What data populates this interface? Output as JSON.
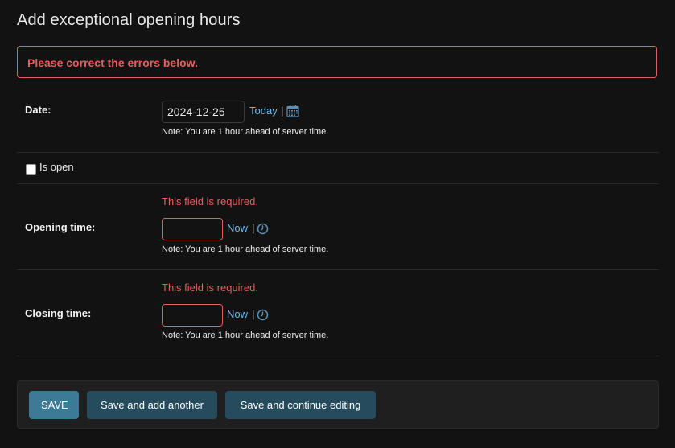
{
  "page": {
    "title": "Add exceptional opening hours",
    "error_note": "Please correct the errors below."
  },
  "date_field": {
    "label": "Date:",
    "value": "2024-12-25",
    "shortcut_label": "Today",
    "separator": "|",
    "icon": "calendar-icon",
    "help": "Note: You are 1 hour ahead of server time."
  },
  "is_open_field": {
    "label": "Is open",
    "checked": false
  },
  "opening_time_field": {
    "label": "Opening time:",
    "error": "This field is required.",
    "value": "",
    "shortcut_label": "Now",
    "separator": "|",
    "icon": "clock-icon",
    "help": "Note: You are 1 hour ahead of server time."
  },
  "closing_time_field": {
    "label": "Closing time:",
    "error": "This field is required.",
    "value": "",
    "shortcut_label": "Now",
    "separator": "|",
    "icon": "clock-icon",
    "help": "Note: You are 1 hour ahead of server time."
  },
  "submit_row": {
    "save_label": "SAVE",
    "save_add_another_label": "Save and add another",
    "save_continue_label": "Save and continue editing"
  },
  "colors": {
    "background": "#121212",
    "error": "#e35f5f",
    "link": "#6fb8e8",
    "primary_button": "#3c7a96",
    "secondary_button": "#264b5d"
  }
}
